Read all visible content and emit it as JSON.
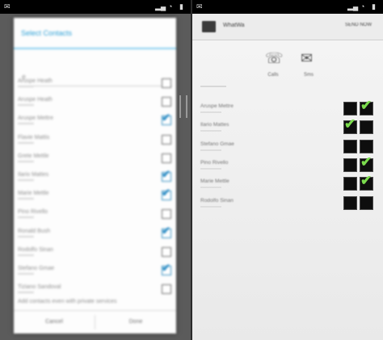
{
  "status_icons": [
    "signal-icon",
    "wifi-icon",
    "battery-icon"
  ],
  "left": {
    "dialog": {
      "title": "Select Contacts",
      "search_value": "e",
      "options": [
        {
          "label": "Aruspe Heath",
          "checked": false
        },
        {
          "label": "Aruspe Heath",
          "checked": false
        },
        {
          "label": "Aruspe Mettre",
          "checked": true
        },
        {
          "label": "Flavie Mattis",
          "checked": false
        },
        {
          "label": "Grete Mettle",
          "checked": false
        },
        {
          "label": "Ilario Mattes",
          "checked": true
        },
        {
          "label": "Marie Mettle",
          "checked": true
        },
        {
          "label": "Pino Rivello",
          "checked": false
        },
        {
          "label": "Ronald Bush",
          "checked": true
        },
        {
          "label": "Rodolfo Sinan",
          "checked": false
        },
        {
          "label": "Stefano Gmae",
          "checked": true
        },
        {
          "label": "Tiziano Sandoval",
          "checked": false
        }
      ],
      "footer_text": "Add contacts even with private services",
      "cancel_label": "Cancel",
      "ok_label": "Done"
    }
  },
  "right": {
    "app_title": "WhatWa",
    "action_text": "SEND NOW",
    "tiles": [
      {
        "icon": "phone-icon",
        "label": "Calls"
      },
      {
        "icon": "sms-icon",
        "label": "Sms"
      }
    ],
    "items": [
      {
        "label": "Aruspe Mettre",
        "a": false,
        "b": true
      },
      {
        "label": "Ilario Mattes",
        "a": true,
        "b": false
      },
      {
        "label": "Stefano Gmae",
        "a": false,
        "b": false
      },
      {
        "label": "Pino Rivello",
        "a": false,
        "b": true
      },
      {
        "label": "Marie Mettle",
        "a": false,
        "b": true
      },
      {
        "label": "Rodolfo Sinan",
        "a": false,
        "b": false
      }
    ],
    "check_color": "#7bdc4d"
  }
}
